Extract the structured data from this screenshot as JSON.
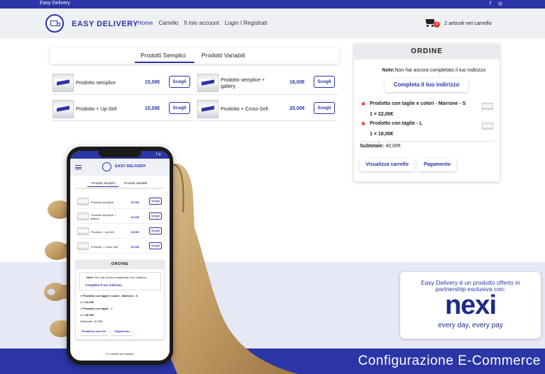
{
  "topbar": {
    "brand": "Easy Delivery",
    "social": [
      "f",
      "◎"
    ]
  },
  "navbar": {
    "logo_text": "EASY DELIVERY",
    "links": [
      "Home",
      "Carrello",
      "Il mio account",
      "Login / Registrati"
    ],
    "cart_count": "2",
    "cart_text": "2 articoli nel carrello"
  },
  "tabs": [
    "Prodotti Semplici",
    "Prodotti Variabili"
  ],
  "products": [
    {
      "name": "Prodotto semplice",
      "price": "15,00€",
      "button": "Scegli"
    },
    {
      "name": "Prodotto semplice + gallery",
      "price": "16,00€",
      "button": "Scegli"
    },
    {
      "name": "Prodotto + Up-Sell",
      "price": "15,00€",
      "button": "Scegli"
    },
    {
      "name": "Prodotto + Cross-Sell",
      "price": "20,00€",
      "button": "Scegli"
    }
  ],
  "order": {
    "title": "ORDINE",
    "note_label": "Note:",
    "note_text": "Non hai ancora completato il tuo indirizzo",
    "complete_button": "Completa il tuo indirizzo",
    "items": [
      {
        "name": "Prodotto con taglie e colori - Marrone - S",
        "qty": "1 × 22,00€"
      },
      {
        "name": "Prodotto con taglie - L",
        "qty": "1 × 18,00€"
      }
    ],
    "subtotal_label": "Subtotale:",
    "subtotal_value": "40,00€",
    "view_cart_button": "Visualizza carrello",
    "checkout_button": "Pagamento"
  },
  "mobile": {
    "logo_text": "EASY DELIVERY",
    "tabs": [
      "Prodotti Semplici",
      "Prodotti Variabili"
    ],
    "products": [
      {
        "name": "Prodotto semplice",
        "price": "15,00€",
        "button": "Scegli"
      },
      {
        "name": "Prodotto semplice + gallery",
        "price": "16,00€",
        "button": "Scegli"
      },
      {
        "name": "Prodotto + Up-Sell",
        "price": "15,00€",
        "button": "Scegli"
      },
      {
        "name": "Prodotto + Cross-Sell",
        "price": "20,00€",
        "button": "Scegli"
      }
    ],
    "order_title": "ORDINE",
    "note_label": "Note:",
    "note_text": "Non hai ancora completato il tuo indirizzo",
    "complete_button": "Completa il tuo indirizzo",
    "item1": "Prodotto con taglie e colori - Marrone - S",
    "item1_qty": "1 × 22,00€",
    "item2": "Prodotto con taglie - L",
    "item2_qty": "1 × 18,00€",
    "subtotal": "Subtotale: 40,00€",
    "view_cart_button": "Visualizza carrello",
    "checkout_button": "Pagamento",
    "cart_text": "2 articoli nel carrello"
  },
  "promo": {
    "tagline": "Easy Delivery è un prodotto offerto in partnership esclusiva con:",
    "logo": "nexi",
    "slogan": "every day, every pay"
  },
  "footer_title": "Configurazione E-Commerce",
  "colors": {
    "brand": "#2b35a6",
    "nexi": "#1e2a8c",
    "remove": "#e53935"
  }
}
